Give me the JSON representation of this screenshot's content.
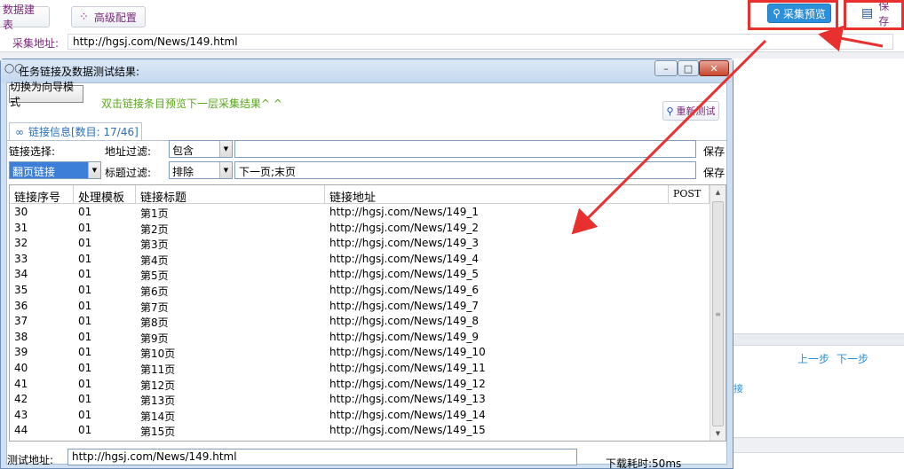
{
  "toolbar": {
    "build_label": "数据建表",
    "advanced_label": "高级配置",
    "advanced_icon": "grid-icon",
    "preview_label": "采集预览",
    "preview_icon": "search-icon",
    "save_label": "保存",
    "save_icon": "floppy-icon"
  },
  "url_row": {
    "label": "采集地址:",
    "value": "http://hgsj.com/News/149.html"
  },
  "background": {
    "prev_label": "上一步",
    "next_label": "下一步",
    "link_fragment": "接"
  },
  "dialog": {
    "title": "任务链接及数据测试结果:",
    "guide_button": "切换为向导模式",
    "hint": "双击链接条目预览下一层采集结果^ ^",
    "retest_label": "重新测试",
    "tab_label": "链接信息[数目: 17/46]",
    "filters": {
      "link_select_label": "链接选择:",
      "link_select_value": "翻页链接",
      "addr_filter_label": "地址过滤:",
      "addr_filter_mode": "包含",
      "addr_filter_value": "",
      "addr_save": "保存",
      "title_filter_label": "标题过滤:",
      "title_filter_mode": "排除",
      "title_filter_value": "下一页;末页",
      "title_save": "保存"
    },
    "grid": {
      "headers": [
        "链接序号",
        "处理模板",
        "链接标题",
        "链接地址",
        "POST"
      ],
      "rows": [
        [
          "30",
          "01",
          "第1页",
          "http://hgsj.com/News/149_1"
        ],
        [
          "31",
          "01",
          "第2页",
          "http://hgsj.com/News/149_2"
        ],
        [
          "32",
          "01",
          "第3页",
          "http://hgsj.com/News/149_3"
        ],
        [
          "33",
          "01",
          "第4页",
          "http://hgsj.com/News/149_4"
        ],
        [
          "34",
          "01",
          "第5页",
          "http://hgsj.com/News/149_5"
        ],
        [
          "35",
          "01",
          "第6页",
          "http://hgsj.com/News/149_6"
        ],
        [
          "36",
          "01",
          "第7页",
          "http://hgsj.com/News/149_7"
        ],
        [
          "37",
          "01",
          "第8页",
          "http://hgsj.com/News/149_8"
        ],
        [
          "38",
          "01",
          "第9页",
          "http://hgsj.com/News/149_9"
        ],
        [
          "39",
          "01",
          "第10页",
          "http://hgsj.com/News/149_10"
        ],
        [
          "40",
          "01",
          "第11页",
          "http://hgsj.com/News/149_11"
        ],
        [
          "41",
          "01",
          "第12页",
          "http://hgsj.com/News/149_12"
        ],
        [
          "42",
          "01",
          "第13页",
          "http://hgsj.com/News/149_13"
        ],
        [
          "43",
          "01",
          "第14页",
          "http://hgsj.com/News/149_14"
        ],
        [
          "44",
          "01",
          "第15页",
          "http://hgsj.com/News/149_15"
        ]
      ]
    },
    "test_label": "测试地址:",
    "test_value": "http://hgsj.com/News/149.html",
    "download_time": "下载耗时:50ms"
  },
  "colors": {
    "annotation_red": "#e8302f",
    "accent_blue": "#2b8fd9",
    "hint_green": "#5aa61d"
  }
}
